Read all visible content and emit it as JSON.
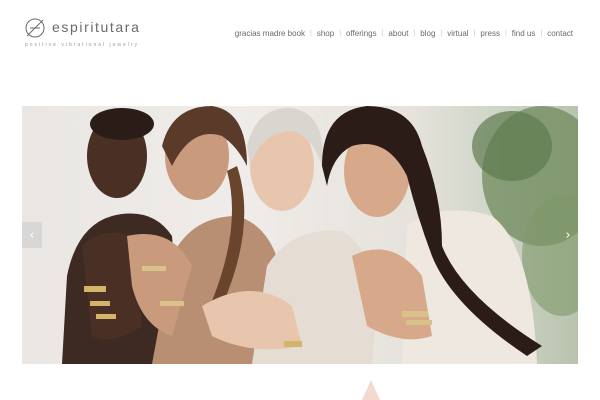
{
  "brand": {
    "name": "espiritutara",
    "tagline": "positive vibrational jewelry"
  },
  "nav": {
    "items": [
      "gracias madre book",
      "shop",
      "offerings",
      "about",
      "blog",
      "virtual",
      "press",
      "find us",
      "contact"
    ],
    "separator": "|"
  },
  "slider": {
    "prev_icon": "‹",
    "next_icon": "›"
  },
  "colors": {
    "text": "#6a6a6a",
    "muted": "#9a9a9a",
    "accent_soft": "#f3d9cf"
  }
}
